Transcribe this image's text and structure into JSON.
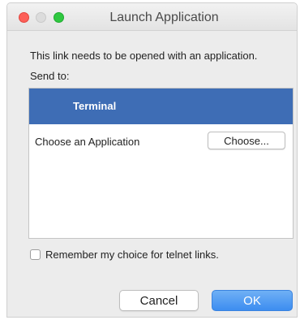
{
  "window": {
    "title": "Launch Application"
  },
  "dialog": {
    "message": "This link needs to be opened with an application.",
    "send_to_label": "Send to:",
    "apps": {
      "selected": "Terminal",
      "choose_label": "Choose an Application",
      "choose_button": "Choose..."
    },
    "remember_label": "Remember my choice for telnet links.",
    "remember_checked": false,
    "cancel_label": "Cancel",
    "ok_label": "OK"
  },
  "colors": {
    "selection": "#3e6db5",
    "ok_button": "#4a94f2",
    "close": "#fd5f58",
    "maximize": "#2fc840"
  }
}
